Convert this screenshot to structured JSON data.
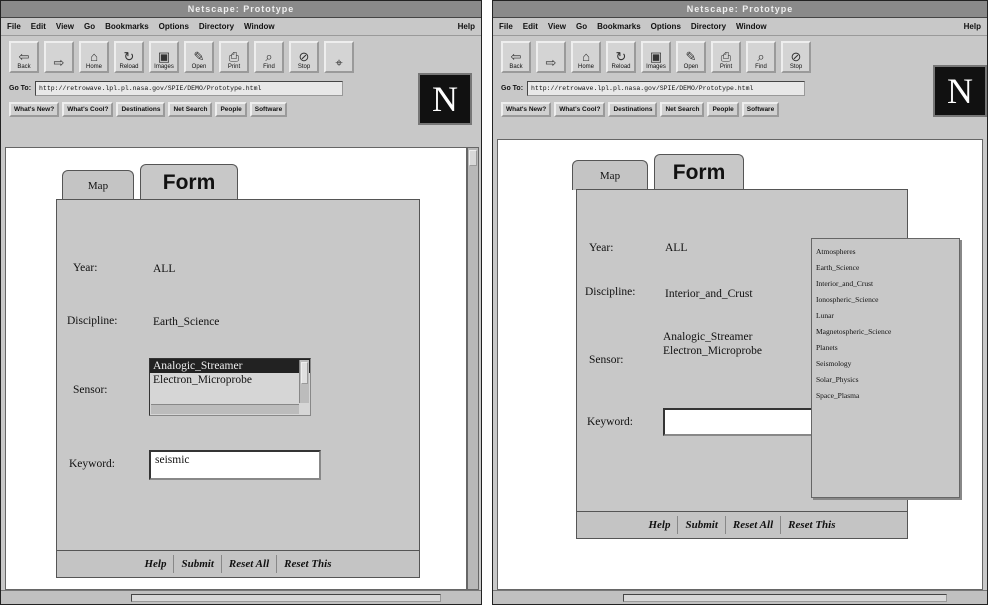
{
  "left": {
    "title": "Netscape: Prototype",
    "menu": [
      "File",
      "Edit",
      "View",
      "Go",
      "Bookmarks",
      "Options",
      "Directory",
      "Window"
    ],
    "menu_help": "Help",
    "toolbar": [
      {
        "icon": "back-icon",
        "glyph": "⇦",
        "label": "Back"
      },
      {
        "icon": "forward-icon",
        "glyph": "⇨",
        "label": ""
      },
      {
        "icon": "home-icon",
        "glyph": "⌂",
        "label": "Home"
      },
      {
        "icon": "reload-icon",
        "glyph": "↻",
        "label": "Reload"
      },
      {
        "icon": "images-icon",
        "glyph": "▣",
        "label": "Images"
      },
      {
        "icon": "open-icon",
        "glyph": "✎",
        "label": "Open"
      },
      {
        "icon": "print-icon",
        "glyph": "⎙",
        "label": "Print"
      },
      {
        "icon": "find-icon",
        "glyph": "⌕",
        "label": "Find"
      },
      {
        "icon": "stop-icon",
        "glyph": "⊘",
        "label": "Stop"
      },
      {
        "icon": "search-icon",
        "glyph": "⌖",
        "label": ""
      }
    ],
    "logo": "N",
    "location_label": "Go To:",
    "location_url": "http://retrowave.lpl.pl.nasa.gov/SPIE/DEMO/Prototype.html",
    "dir_buttons": [
      "What's New?",
      "What's Cool?",
      "Destinations",
      "Net Search",
      "People",
      "Software"
    ],
    "tabs": {
      "map": "Map",
      "form": "Form"
    },
    "fields": {
      "year_label": "Year:",
      "year_value": "ALL",
      "discipline_label": "Discipline:",
      "discipline_value": "Earth_Science",
      "sensor_label": "Sensor:",
      "sensor_options": [
        "Analogic_Streamer",
        "Electron_Microprobe"
      ],
      "sensor_selected": "Analogic_Streamer",
      "keyword_label": "Keyword:",
      "keyword_value": "seismic"
    },
    "buttons": [
      "Help",
      "Submit",
      "Reset All",
      "Reset This"
    ]
  },
  "right": {
    "title": "Netscape: Prototype",
    "menu": [
      "File",
      "Edit",
      "View",
      "Go",
      "Bookmarks",
      "Options",
      "Directory",
      "Window"
    ],
    "menu_help": "Help",
    "toolbar": [
      {
        "icon": "back-icon",
        "glyph": "⇦",
        "label": "Back"
      },
      {
        "icon": "forward-icon",
        "glyph": "⇨",
        "label": ""
      },
      {
        "icon": "home-icon",
        "glyph": "⌂",
        "label": "Home"
      },
      {
        "icon": "reload-icon",
        "glyph": "↻",
        "label": "Reload"
      },
      {
        "icon": "images-icon",
        "glyph": "▣",
        "label": "Images"
      },
      {
        "icon": "open-icon",
        "glyph": "✎",
        "label": "Open"
      },
      {
        "icon": "print-icon",
        "glyph": "⎙",
        "label": "Print"
      },
      {
        "icon": "find-icon",
        "glyph": "⌕",
        "label": "Find"
      },
      {
        "icon": "stop-icon",
        "glyph": "⊘",
        "label": "Stop"
      }
    ],
    "logo": "N",
    "location_label": "Go To:",
    "location_url": "http://retrowave.lpl.pl.nasa.gov/SPIE/DEMO/Prototype.html",
    "dir_buttons": [
      "What's New?",
      "What's Cool?",
      "Destinations",
      "Net Search",
      "People",
      "Software"
    ],
    "tabs": {
      "map": "Map",
      "form": "Form"
    },
    "fields": {
      "year_label": "Year:",
      "year_value": "ALL",
      "discipline_label": "Discipline:",
      "discipline_value": "Interior_and_Crust",
      "sensor_label": "Sensor:",
      "sensor_options": [
        "Analogic_Streamer",
        "Electron_Microprobe"
      ],
      "keyword_label": "Keyword:",
      "keyword_value": ""
    },
    "discipline_popup": [
      "Atmospheres",
      "Earth_Science",
      "Interior_and_Crust",
      "Ionospheric_Science",
      "Lunar",
      "Magnetospheric_Science",
      "Planets",
      "Seismology",
      "Solar_Physics",
      "Space_Plasma"
    ],
    "buttons": [
      "Help",
      "Submit",
      "Reset All",
      "Reset This"
    ]
  }
}
